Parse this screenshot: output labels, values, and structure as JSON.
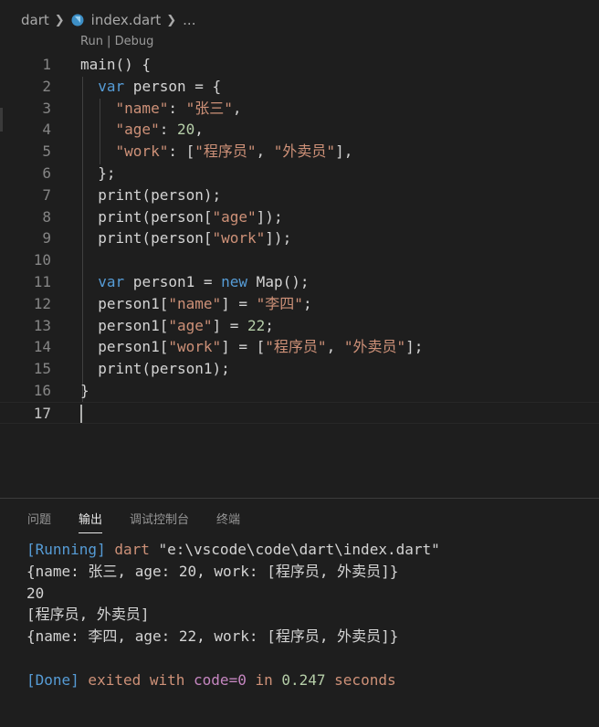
{
  "breadcrumb": {
    "folder": "dart",
    "file": "index.dart",
    "more": "..."
  },
  "codelens": "Run | Debug",
  "editor": {
    "current_line": 17,
    "lines": [
      {
        "n": "1",
        "tokens": [
          {
            "t": "main() {",
            "c": "plain"
          }
        ]
      },
      {
        "n": "2",
        "tokens": [
          {
            "t": "  ",
            "c": "plain"
          },
          {
            "t": "var",
            "c": "kw"
          },
          {
            "t": " person = {",
            "c": "plain"
          }
        ]
      },
      {
        "n": "3",
        "tokens": [
          {
            "t": "    ",
            "c": "plain"
          },
          {
            "t": "\"name\"",
            "c": "str"
          },
          {
            "t": ": ",
            "c": "plain"
          },
          {
            "t": "\"张三\"",
            "c": "str"
          },
          {
            "t": ",",
            "c": "plain"
          }
        ]
      },
      {
        "n": "4",
        "tokens": [
          {
            "t": "    ",
            "c": "plain"
          },
          {
            "t": "\"age\"",
            "c": "str"
          },
          {
            "t": ": ",
            "c": "plain"
          },
          {
            "t": "20",
            "c": "num"
          },
          {
            "t": ",",
            "c": "plain"
          }
        ]
      },
      {
        "n": "5",
        "tokens": [
          {
            "t": "    ",
            "c": "plain"
          },
          {
            "t": "\"work\"",
            "c": "str"
          },
          {
            "t": ": [",
            "c": "plain"
          },
          {
            "t": "\"程序员\"",
            "c": "str"
          },
          {
            "t": ", ",
            "c": "plain"
          },
          {
            "t": "\"外卖员\"",
            "c": "str"
          },
          {
            "t": "],",
            "c": "plain"
          }
        ]
      },
      {
        "n": "6",
        "tokens": [
          {
            "t": "  };",
            "c": "plain"
          }
        ]
      },
      {
        "n": "7",
        "tokens": [
          {
            "t": "  print(person);",
            "c": "plain"
          }
        ]
      },
      {
        "n": "8",
        "tokens": [
          {
            "t": "  print(person[",
            "c": "plain"
          },
          {
            "t": "\"age\"",
            "c": "str"
          },
          {
            "t": "]);",
            "c": "plain"
          }
        ]
      },
      {
        "n": "9",
        "tokens": [
          {
            "t": "  print(person[",
            "c": "plain"
          },
          {
            "t": "\"work\"",
            "c": "str"
          },
          {
            "t": "]);",
            "c": "plain"
          }
        ]
      },
      {
        "n": "10",
        "tokens": []
      },
      {
        "n": "11",
        "tokens": [
          {
            "t": "  ",
            "c": "plain"
          },
          {
            "t": "var",
            "c": "kw"
          },
          {
            "t": " person1 = ",
            "c": "plain"
          },
          {
            "t": "new",
            "c": "kw"
          },
          {
            "t": " Map();",
            "c": "plain"
          }
        ]
      },
      {
        "n": "12",
        "tokens": [
          {
            "t": "  person1[",
            "c": "plain"
          },
          {
            "t": "\"name\"",
            "c": "str"
          },
          {
            "t": "] = ",
            "c": "plain"
          },
          {
            "t": "\"李四\"",
            "c": "str"
          },
          {
            "t": ";",
            "c": "plain"
          }
        ]
      },
      {
        "n": "13",
        "tokens": [
          {
            "t": "  person1[",
            "c": "plain"
          },
          {
            "t": "\"age\"",
            "c": "str"
          },
          {
            "t": "] = ",
            "c": "plain"
          },
          {
            "t": "22",
            "c": "num"
          },
          {
            "t": ";",
            "c": "plain"
          }
        ]
      },
      {
        "n": "14",
        "tokens": [
          {
            "t": "  person1[",
            "c": "plain"
          },
          {
            "t": "\"work\"",
            "c": "str"
          },
          {
            "t": "] = [",
            "c": "plain"
          },
          {
            "t": "\"程序员\"",
            "c": "str"
          },
          {
            "t": ", ",
            "c": "plain"
          },
          {
            "t": "\"外卖员\"",
            "c": "str"
          },
          {
            "t": "];",
            "c": "plain"
          }
        ]
      },
      {
        "n": "15",
        "tokens": [
          {
            "t": "  print(person1);",
            "c": "plain"
          }
        ]
      },
      {
        "n": "16",
        "tokens": [
          {
            "t": "}",
            "c": "plain"
          }
        ]
      },
      {
        "n": "17",
        "tokens": []
      }
    ]
  },
  "panel": {
    "tabs": [
      {
        "label": "问题",
        "active": false
      },
      {
        "label": "输出",
        "active": true
      },
      {
        "label": "调试控制台",
        "active": false
      },
      {
        "label": "终端",
        "active": false
      }
    ],
    "output": [
      [
        {
          "t": "[Running]",
          "c": "c-blue"
        },
        {
          "t": " dart ",
          "c": "c-orange"
        },
        {
          "t": "\"e:\\vscode\\code\\dart\\index.dart\"",
          "c": "plain"
        }
      ],
      [
        {
          "t": "{name: 张三, age: 20, work: [程序员, 外卖员]}",
          "c": "plain"
        }
      ],
      [
        {
          "t": "20",
          "c": "plain"
        }
      ],
      [
        {
          "t": "[程序员, 外卖员]",
          "c": "plain"
        }
      ],
      [
        {
          "t": "{name: 李四, age: 22, work: [程序员, 外卖员]}",
          "c": "plain"
        }
      ],
      [],
      [
        {
          "t": "[Done]",
          "c": "c-blue"
        },
        {
          "t": " exited with ",
          "c": "c-orange"
        },
        {
          "t": "code=0",
          "c": "c-purple"
        },
        {
          "t": " in ",
          "c": "c-orange"
        },
        {
          "t": "0.247",
          "c": "c-green"
        },
        {
          "t": " seconds",
          "c": "c-orange"
        }
      ]
    ]
  },
  "colors": {
    "background": "#1e1e1e",
    "keyword": "#569cd6",
    "string": "#ce9178",
    "number": "#b5cea8",
    "purple": "#c586c0"
  }
}
